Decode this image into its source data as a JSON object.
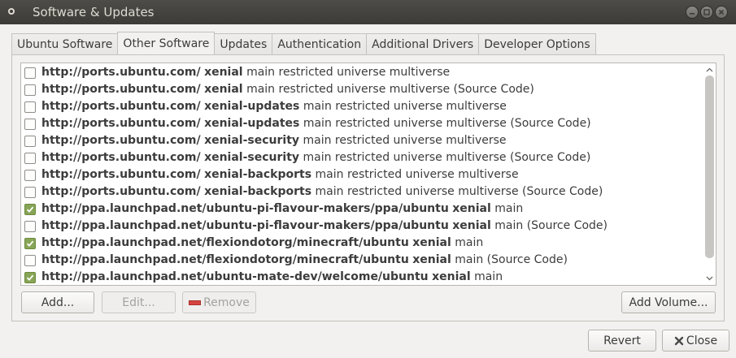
{
  "window": {
    "title": "Software & Updates",
    "icons": {
      "app": "app-icon",
      "minimize": "minimize-icon",
      "maximize": "maximize-icon",
      "close": "close-icon"
    }
  },
  "tabs": [
    {
      "label": "Ubuntu Software",
      "active": false
    },
    {
      "label": "Other Software",
      "active": true
    },
    {
      "label": "Updates",
      "active": false
    },
    {
      "label": "Authentication",
      "active": false
    },
    {
      "label": "Additional Drivers",
      "active": false
    },
    {
      "label": "Developer Options",
      "active": false
    }
  ],
  "sources": [
    {
      "url": "http://ports.ubuntu.com/",
      "dist": "xenial",
      "rest": "main restricted universe multiverse",
      "checked": false
    },
    {
      "url": "http://ports.ubuntu.com/",
      "dist": "xenial",
      "rest": "main restricted universe multiverse (Source Code)",
      "checked": false
    },
    {
      "url": "http://ports.ubuntu.com/",
      "dist": "xenial-updates",
      "rest": "main restricted universe multiverse",
      "checked": false
    },
    {
      "url": "http://ports.ubuntu.com/",
      "dist": "xenial-updates",
      "rest": "main restricted universe multiverse (Source Code)",
      "checked": false
    },
    {
      "url": "http://ports.ubuntu.com/",
      "dist": "xenial-security",
      "rest": "main restricted universe multiverse",
      "checked": false
    },
    {
      "url": "http://ports.ubuntu.com/",
      "dist": "xenial-security",
      "rest": "main restricted universe multiverse (Source Code)",
      "checked": false
    },
    {
      "url": "http://ports.ubuntu.com/",
      "dist": "xenial-backports",
      "rest": "main restricted universe multiverse",
      "checked": false
    },
    {
      "url": "http://ports.ubuntu.com/",
      "dist": "xenial-backports",
      "rest": "main restricted universe multiverse (Source Code)",
      "checked": false
    },
    {
      "url": "http://ppa.launchpad.net/ubuntu-pi-flavour-makers/ppa/ubuntu",
      "dist": "xenial",
      "rest": "main",
      "checked": true
    },
    {
      "url": "http://ppa.launchpad.net/ubuntu-pi-flavour-makers/ppa/ubuntu",
      "dist": "xenial",
      "rest": "main (Source Code)",
      "checked": false
    },
    {
      "url": "http://ppa.launchpad.net/flexiondotorg/minecraft/ubuntu",
      "dist": "xenial",
      "rest": "main",
      "checked": true
    },
    {
      "url": "http://ppa.launchpad.net/flexiondotorg/minecraft/ubuntu",
      "dist": "xenial",
      "rest": "main (Source Code)",
      "checked": false
    },
    {
      "url": "http://ppa.launchpad.net/ubuntu-mate-dev/welcome/ubuntu",
      "dist": "xenial",
      "rest": "main",
      "checked": true
    }
  ],
  "actions": {
    "add": "Add...",
    "edit": "Edit...",
    "remove": "Remove",
    "add_volume": "Add Volume..."
  },
  "footer": {
    "revert": "Revert",
    "close": "Close"
  },
  "colors": {
    "titlebar": "#3c3b37",
    "check": "#87a556",
    "remove": "#d64541",
    "background": "#f2f1f0"
  }
}
